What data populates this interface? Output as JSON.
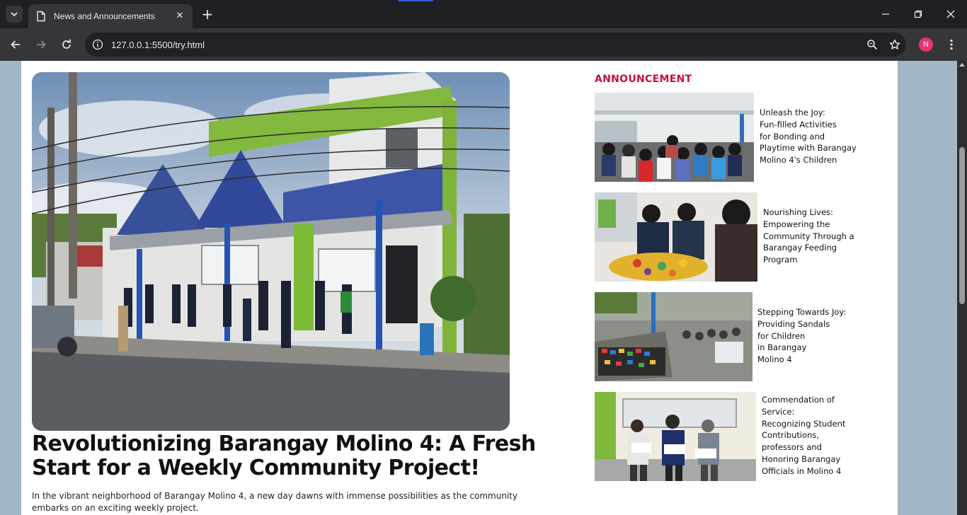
{
  "browser": {
    "tab_title": "News and Announcements",
    "url": "127.0.0.1:5500/try.html",
    "profile_initial": "N"
  },
  "colors": {
    "accent": "#c8103f",
    "page_background": "#a2b6c6"
  },
  "article": {
    "headline": "Revolutionizing Barangay Molino 4: A Fresh Start for a Weekly Community Project!",
    "lead": "In the vibrant neighborhood of Barangay Molino 4, a new day dawns with immense possibilities as the community embarks on an exciting weekly project."
  },
  "announcements": {
    "heading": "ANNOUNCEMENT",
    "items": [
      {
        "title": "Unleash the Joy:\nFun-filled Activities\nfor Bonding and\nPlaytime with Barangay\nMolino 4's Children"
      },
      {
        "title": "Nourishing Lives:\nEmpowering the\nCommunity Through a\nBarangay Feeding\nProgram"
      },
      {
        "title": "Stepping Towards Joy:\nProviding Sandals\nfor Children\nin Barangay\nMolino 4"
      },
      {
        "title": "Commendation of\nService:\nRecognizing Student\nContributions,\nprofessors and\nHonoring Barangay\nOfficials in Molino 4"
      }
    ]
  }
}
